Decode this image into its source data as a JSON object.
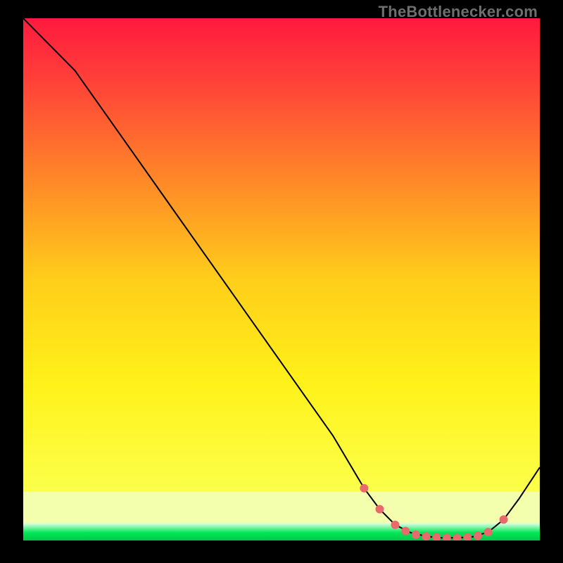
{
  "watermark": "TheBottlenecker.com",
  "colors": {
    "bg": "#000000",
    "curve": "#000000",
    "marker": "#e86a6c",
    "grad_top": "#ff1a3e",
    "grad_mid": "#fff31a",
    "grad_band": "#f6ffbf",
    "grad_green": "#00e756"
  },
  "chart_data": {
    "type": "line",
    "title": "",
    "xlabel": "",
    "ylabel": "",
    "xlim": [
      0,
      100
    ],
    "ylim": [
      0,
      100
    ],
    "x": [
      0,
      3,
      6,
      10,
      15,
      20,
      25,
      30,
      35,
      40,
      45,
      50,
      55,
      60,
      63,
      66,
      69,
      72,
      75,
      78,
      81,
      84,
      87,
      90,
      93,
      96,
      100
    ],
    "y": [
      100,
      97,
      94,
      90,
      83,
      76,
      69,
      62,
      55,
      48,
      41,
      34,
      27,
      20,
      15,
      10,
      6,
      3,
      1.5,
      0.8,
      0.5,
      0.5,
      0.7,
      1.6,
      4,
      8,
      14
    ],
    "markers": {
      "x": [
        66,
        69,
        72,
        74,
        76,
        78,
        80,
        82,
        84,
        86,
        88,
        90,
        93
      ],
      "y": [
        10,
        6,
        3,
        1.8,
        1.1,
        0.8,
        0.6,
        0.5,
        0.5,
        0.6,
        0.9,
        1.6,
        4
      ]
    }
  }
}
